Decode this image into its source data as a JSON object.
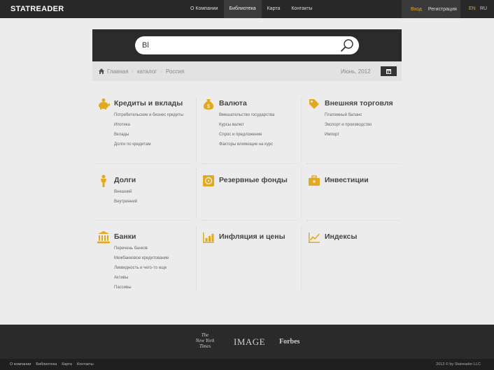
{
  "header": {
    "logo": "STATREADER",
    "nav": [
      "О Компании",
      "Библиотека",
      "Карта",
      "Контакты"
    ],
    "active_nav": "Библиотека",
    "login": "Вход",
    "register": "Регистрация",
    "lang_en": "EN",
    "lang_ru": "RU"
  },
  "search": {
    "value": "Bl",
    "icon": "search-icon"
  },
  "breadcrumb": {
    "items": [
      "Главная",
      "каталог",
      "Россия"
    ],
    "date": "Июнь, 2012"
  },
  "colors": {
    "accent": "#e3a91a",
    "dark": "#282828",
    "background": "#ececec"
  },
  "categories": [
    {
      "title": "Кредиты и вклады",
      "icon": "piggy-bank-icon",
      "links": [
        "Потребительские и бизнес кредиты",
        "Ипотека",
        "Вклады",
        "Долги по кредитам"
      ]
    },
    {
      "title": "Валюта",
      "icon": "money-bag-icon",
      "links": [
        "Вмешательство государства",
        "Курсы валют",
        "Спрос и предложение",
        "Факторы влияющие на курс"
      ]
    },
    {
      "title": "Внешняя торговля",
      "icon": "price-tag-icon",
      "links": [
        "Платежный баланс",
        "Экспорт и производство",
        "Импорт"
      ]
    },
    {
      "title": "Долги",
      "icon": "person-icon",
      "links": [
        "Внешний",
        "Внутренний"
      ]
    },
    {
      "title": "Резервные фонды",
      "icon": "safe-icon",
      "links": []
    },
    {
      "title": "Инвестиции",
      "icon": "briefcase-icon",
      "links": []
    },
    {
      "title": "Банки",
      "icon": "bank-building-icon",
      "links": [
        "Перечень банков",
        "Межбанковое кредитование",
        "Ликвидность и чего-то еще",
        "Активы",
        "Пассивы"
      ]
    },
    {
      "title": "Инфляция и цены",
      "icon": "bar-chart-icon",
      "links": []
    },
    {
      "title": "Индексы",
      "icon": "line-chart-icon",
      "links": []
    }
  ],
  "footer": {
    "press": [
      "The New York Times",
      "IMAGE",
      "Forbes"
    ],
    "links": [
      "О компании",
      "Библиотека",
      "Карта",
      "Контакты"
    ],
    "copyright": "2013 © by Statreader LLC"
  }
}
